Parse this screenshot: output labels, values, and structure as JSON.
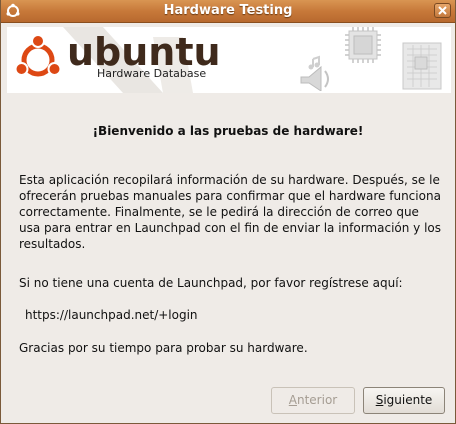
{
  "window": {
    "title": "Hardware Testing"
  },
  "banner": {
    "logo_text": "ubuntu",
    "logo_subtitle": "Hardware Database",
    "icons": [
      "ubuntu-logo-icon",
      "chip-icon",
      "speaker-icon",
      "circuit-board-icon"
    ]
  },
  "content": {
    "heading": "¡Bienvenido a las pruebas de hardware!",
    "intro": "Esta aplicación recopilará información de su hardware. Después, se le ofrecerán pruebas manuales para confirmar que el hardware funciona correctamente. Finalmente, se le pedirá la dirección de correo que usa para entrar en Launchpad con el fin de enviar la información y los resultados.",
    "register_prompt": "Si no tiene una cuenta de Launchpad, por favor regístrese aquí:",
    "register_url": "https://launchpad.net/+login",
    "thanks": "Gracias por su tiempo para probar su hardware."
  },
  "buttons": {
    "previous_first": "A",
    "previous_rest": "nterior",
    "next_first": "S",
    "next_rest": "iguiente"
  },
  "colors": {
    "titlebar": "#c7793a",
    "background": "#efebe7",
    "ubuntu_orange": "#dd4814",
    "ubuntu_brown": "#3f2a1c"
  }
}
